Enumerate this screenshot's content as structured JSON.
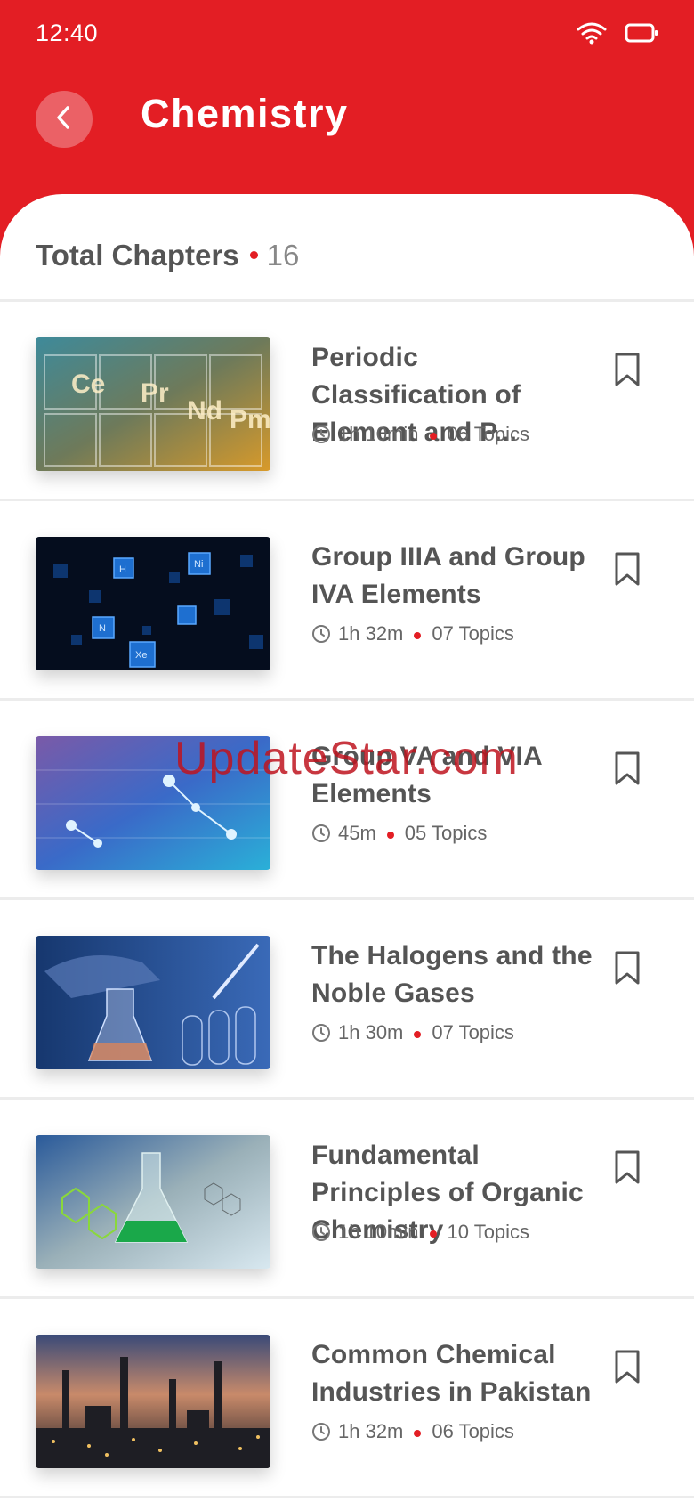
{
  "status_bar": {
    "time": "12:40",
    "wifi_icon": "wifi-icon",
    "battery_icon": "battery-icon"
  },
  "header": {
    "title": "Chemistry",
    "back_icon": "chevron-left-icon"
  },
  "summary": {
    "label": "Total Chapters",
    "count": "16"
  },
  "chapters": [
    {
      "title": "Periodic Classification of Element and P...",
      "duration": "1h 10min",
      "topics": "05 Topics",
      "thumbnail": "periodic-table"
    },
    {
      "title": "Group IIIA and Group IVA Elements",
      "duration": "1h 32m",
      "topics": "07 Topics",
      "thumbnail": "element-tiles"
    },
    {
      "title": "Group VA and VIA Elements",
      "duration": "45m",
      "topics": "05 Topics",
      "thumbnail": "molecules"
    },
    {
      "title": "The Halogens and the Noble Gases",
      "duration": "1h 30m",
      "topics": "07 Topics",
      "thumbnail": "lab-glassware"
    },
    {
      "title": "Fundamental Principles of Organic Chemistry",
      "duration": "1h 10min",
      "topics": "10 Topics",
      "thumbnail": "flask-structures"
    },
    {
      "title": "Common Chemical Industries in Pakistan",
      "duration": "1h 32m",
      "topics": "06 Topics",
      "thumbnail": "refinery"
    }
  ],
  "watermark": "UpdateStar.com",
  "colors": {
    "accent": "#e31e24",
    "title_text": "#555555",
    "meta_text": "#666666"
  }
}
